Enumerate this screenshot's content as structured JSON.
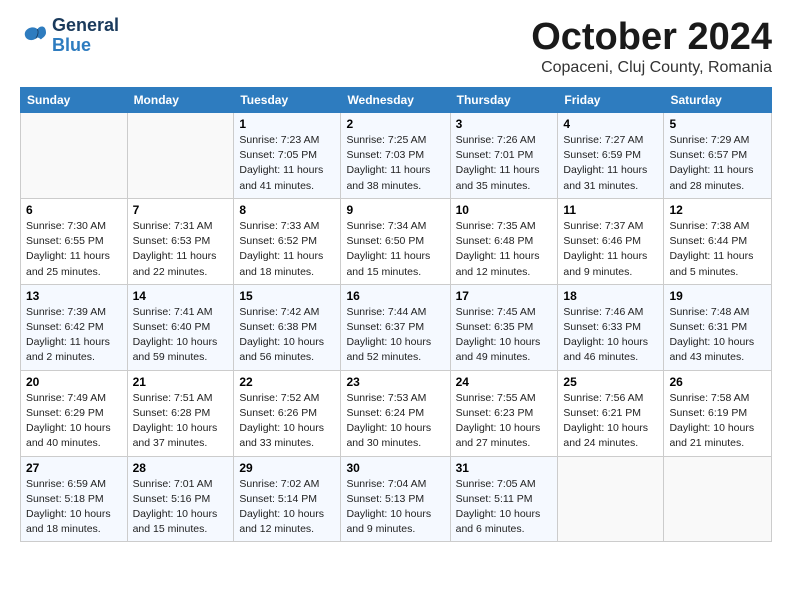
{
  "header": {
    "logo_line1": "General",
    "logo_line2": "Blue",
    "title": "October 2024",
    "subtitle": "Copaceni, Cluj County, Romania"
  },
  "weekdays": [
    "Sunday",
    "Monday",
    "Tuesday",
    "Wednesday",
    "Thursday",
    "Friday",
    "Saturday"
  ],
  "weeks": [
    [
      {
        "day": "",
        "sunrise": "",
        "sunset": "",
        "daylight": ""
      },
      {
        "day": "",
        "sunrise": "",
        "sunset": "",
        "daylight": ""
      },
      {
        "day": "1",
        "sunrise": "Sunrise: 7:23 AM",
        "sunset": "Sunset: 7:05 PM",
        "daylight": "Daylight: 11 hours and 41 minutes."
      },
      {
        "day": "2",
        "sunrise": "Sunrise: 7:25 AM",
        "sunset": "Sunset: 7:03 PM",
        "daylight": "Daylight: 11 hours and 38 minutes."
      },
      {
        "day": "3",
        "sunrise": "Sunrise: 7:26 AM",
        "sunset": "Sunset: 7:01 PM",
        "daylight": "Daylight: 11 hours and 35 minutes."
      },
      {
        "day": "4",
        "sunrise": "Sunrise: 7:27 AM",
        "sunset": "Sunset: 6:59 PM",
        "daylight": "Daylight: 11 hours and 31 minutes."
      },
      {
        "day": "5",
        "sunrise": "Sunrise: 7:29 AM",
        "sunset": "Sunset: 6:57 PM",
        "daylight": "Daylight: 11 hours and 28 minutes."
      }
    ],
    [
      {
        "day": "6",
        "sunrise": "Sunrise: 7:30 AM",
        "sunset": "Sunset: 6:55 PM",
        "daylight": "Daylight: 11 hours and 25 minutes."
      },
      {
        "day": "7",
        "sunrise": "Sunrise: 7:31 AM",
        "sunset": "Sunset: 6:53 PM",
        "daylight": "Daylight: 11 hours and 22 minutes."
      },
      {
        "day": "8",
        "sunrise": "Sunrise: 7:33 AM",
        "sunset": "Sunset: 6:52 PM",
        "daylight": "Daylight: 11 hours and 18 minutes."
      },
      {
        "day": "9",
        "sunrise": "Sunrise: 7:34 AM",
        "sunset": "Sunset: 6:50 PM",
        "daylight": "Daylight: 11 hours and 15 minutes."
      },
      {
        "day": "10",
        "sunrise": "Sunrise: 7:35 AM",
        "sunset": "Sunset: 6:48 PM",
        "daylight": "Daylight: 11 hours and 12 minutes."
      },
      {
        "day": "11",
        "sunrise": "Sunrise: 7:37 AM",
        "sunset": "Sunset: 6:46 PM",
        "daylight": "Daylight: 11 hours and 9 minutes."
      },
      {
        "day": "12",
        "sunrise": "Sunrise: 7:38 AM",
        "sunset": "Sunset: 6:44 PM",
        "daylight": "Daylight: 11 hours and 5 minutes."
      }
    ],
    [
      {
        "day": "13",
        "sunrise": "Sunrise: 7:39 AM",
        "sunset": "Sunset: 6:42 PM",
        "daylight": "Daylight: 11 hours and 2 minutes."
      },
      {
        "day": "14",
        "sunrise": "Sunrise: 7:41 AM",
        "sunset": "Sunset: 6:40 PM",
        "daylight": "Daylight: 10 hours and 59 minutes."
      },
      {
        "day": "15",
        "sunrise": "Sunrise: 7:42 AM",
        "sunset": "Sunset: 6:38 PM",
        "daylight": "Daylight: 10 hours and 56 minutes."
      },
      {
        "day": "16",
        "sunrise": "Sunrise: 7:44 AM",
        "sunset": "Sunset: 6:37 PM",
        "daylight": "Daylight: 10 hours and 52 minutes."
      },
      {
        "day": "17",
        "sunrise": "Sunrise: 7:45 AM",
        "sunset": "Sunset: 6:35 PM",
        "daylight": "Daylight: 10 hours and 49 minutes."
      },
      {
        "day": "18",
        "sunrise": "Sunrise: 7:46 AM",
        "sunset": "Sunset: 6:33 PM",
        "daylight": "Daylight: 10 hours and 46 minutes."
      },
      {
        "day": "19",
        "sunrise": "Sunrise: 7:48 AM",
        "sunset": "Sunset: 6:31 PM",
        "daylight": "Daylight: 10 hours and 43 minutes."
      }
    ],
    [
      {
        "day": "20",
        "sunrise": "Sunrise: 7:49 AM",
        "sunset": "Sunset: 6:29 PM",
        "daylight": "Daylight: 10 hours and 40 minutes."
      },
      {
        "day": "21",
        "sunrise": "Sunrise: 7:51 AM",
        "sunset": "Sunset: 6:28 PM",
        "daylight": "Daylight: 10 hours and 37 minutes."
      },
      {
        "day": "22",
        "sunrise": "Sunrise: 7:52 AM",
        "sunset": "Sunset: 6:26 PM",
        "daylight": "Daylight: 10 hours and 33 minutes."
      },
      {
        "day": "23",
        "sunrise": "Sunrise: 7:53 AM",
        "sunset": "Sunset: 6:24 PM",
        "daylight": "Daylight: 10 hours and 30 minutes."
      },
      {
        "day": "24",
        "sunrise": "Sunrise: 7:55 AM",
        "sunset": "Sunset: 6:23 PM",
        "daylight": "Daylight: 10 hours and 27 minutes."
      },
      {
        "day": "25",
        "sunrise": "Sunrise: 7:56 AM",
        "sunset": "Sunset: 6:21 PM",
        "daylight": "Daylight: 10 hours and 24 minutes."
      },
      {
        "day": "26",
        "sunrise": "Sunrise: 7:58 AM",
        "sunset": "Sunset: 6:19 PM",
        "daylight": "Daylight: 10 hours and 21 minutes."
      }
    ],
    [
      {
        "day": "27",
        "sunrise": "Sunrise: 6:59 AM",
        "sunset": "Sunset: 5:18 PM",
        "daylight": "Daylight: 10 hours and 18 minutes."
      },
      {
        "day": "28",
        "sunrise": "Sunrise: 7:01 AM",
        "sunset": "Sunset: 5:16 PM",
        "daylight": "Daylight: 10 hours and 15 minutes."
      },
      {
        "day": "29",
        "sunrise": "Sunrise: 7:02 AM",
        "sunset": "Sunset: 5:14 PM",
        "daylight": "Daylight: 10 hours and 12 minutes."
      },
      {
        "day": "30",
        "sunrise": "Sunrise: 7:04 AM",
        "sunset": "Sunset: 5:13 PM",
        "daylight": "Daylight: 10 hours and 9 minutes."
      },
      {
        "day": "31",
        "sunrise": "Sunrise: 7:05 AM",
        "sunset": "Sunset: 5:11 PM",
        "daylight": "Daylight: 10 hours and 6 minutes."
      },
      {
        "day": "",
        "sunrise": "",
        "sunset": "",
        "daylight": ""
      },
      {
        "day": "",
        "sunrise": "",
        "sunset": "",
        "daylight": ""
      }
    ]
  ]
}
